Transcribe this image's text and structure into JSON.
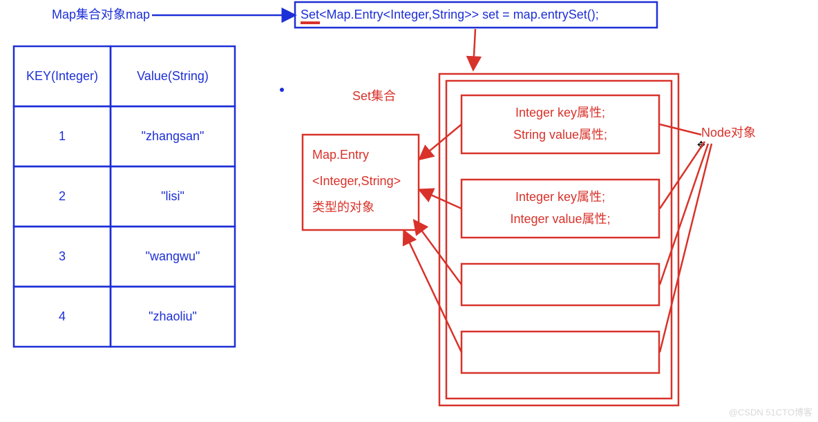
{
  "title": "Map集合对象map",
  "codeLine": "Set<Map.Entry<Integer,String>> set = map.entrySet();",
  "codePrefix": "Set",
  "mapTable": {
    "keyHeader": "KEY(Integer)",
    "valueHeader": "Value(String)",
    "rows": [
      {
        "key": "1",
        "value": "\"zhangsan\""
      },
      {
        "key": "2",
        "value": "\"lisi\""
      },
      {
        "key": "3",
        "value": "\"wangwu\""
      },
      {
        "key": "4",
        "value": "\"zhaoliu\""
      }
    ]
  },
  "setLabel": "Set集合",
  "entryBox": {
    "line1": "Map.Entry",
    "line2": "<Integer,String>",
    "line3": "类型的对象"
  },
  "nodes": [
    {
      "line1": "Integer key属性;",
      "line2": "String value属性;"
    },
    {
      "line1": "Integer key属性;",
      "line2": "Integer value属性;"
    },
    {
      "line1": "",
      "line2": ""
    },
    {
      "line1": "",
      "line2": ""
    }
  ],
  "nodeLabel": "Node对象",
  "watermark": "@CSDN 51CTO博客"
}
